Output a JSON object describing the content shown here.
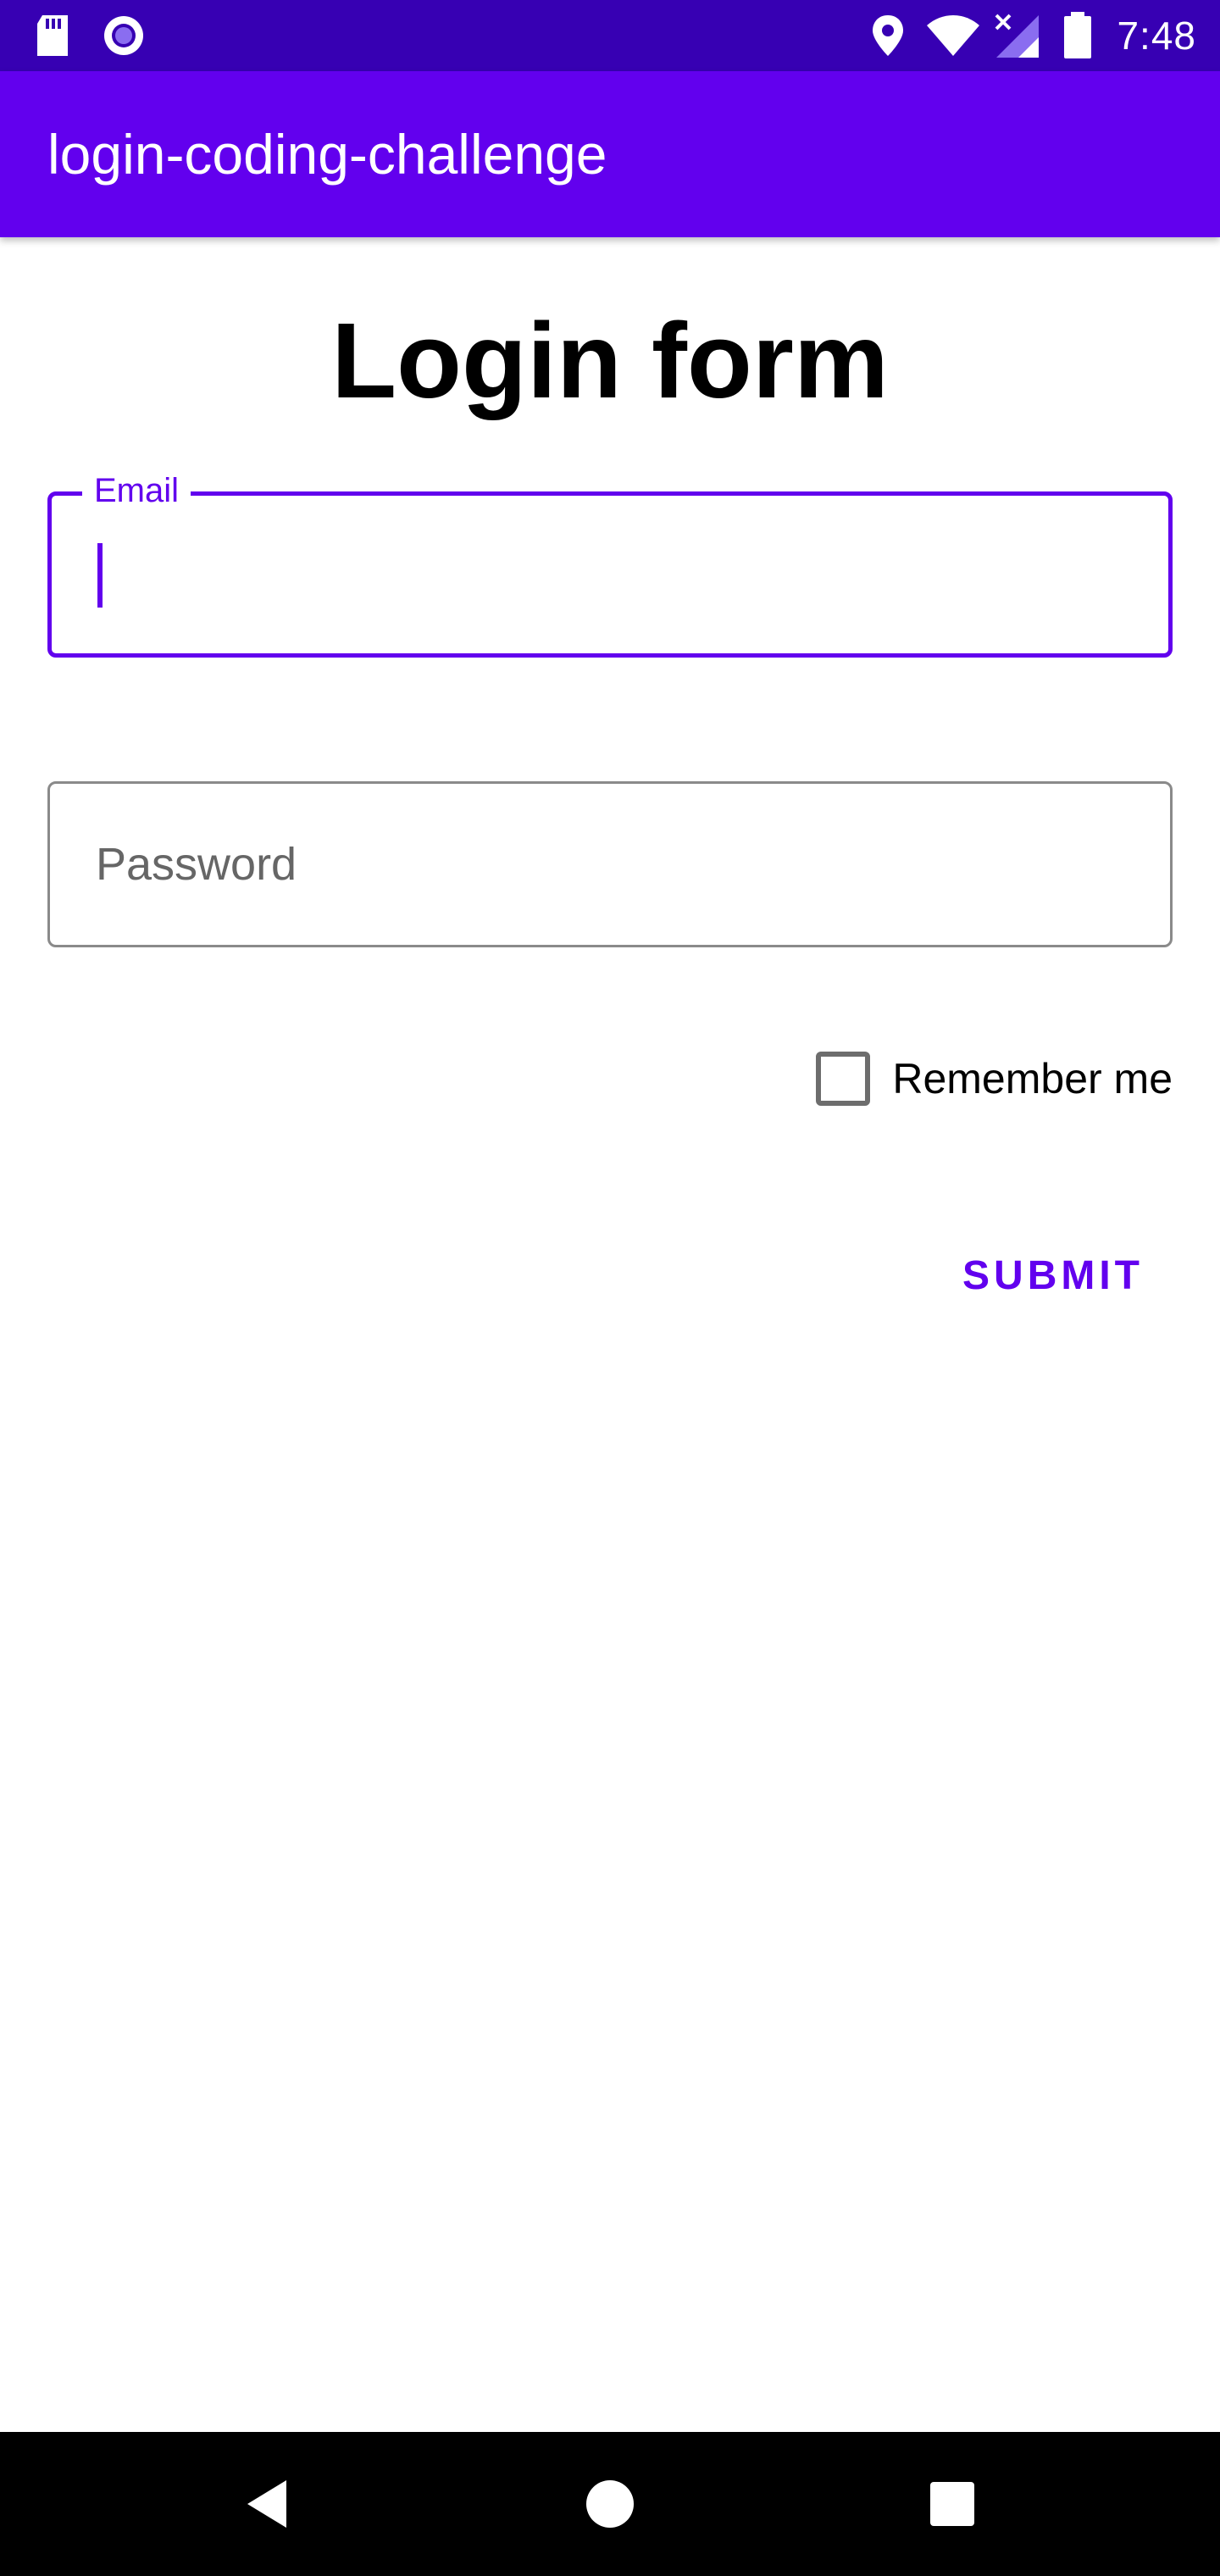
{
  "status_bar": {
    "time": "7:48",
    "icons": [
      "sd-card-icon",
      "media-record-icon",
      "location-icon",
      "wifi-icon",
      "no-signal-icon",
      "battery-icon"
    ]
  },
  "app_bar": {
    "title": "login-coding-challenge"
  },
  "form": {
    "title": "Login form",
    "email": {
      "label": "Email",
      "value": ""
    },
    "password": {
      "placeholder": "Password",
      "value": ""
    },
    "remember_me": {
      "label": "Remember me",
      "checked": false
    },
    "submit_label": "SUBMIT"
  },
  "nav_bar": {
    "buttons": [
      "back-icon",
      "home-icon",
      "recents-icon"
    ]
  },
  "colors": {
    "primary": "#6200ee",
    "primary_dark": "#3700b3",
    "background": "#ffffff"
  }
}
